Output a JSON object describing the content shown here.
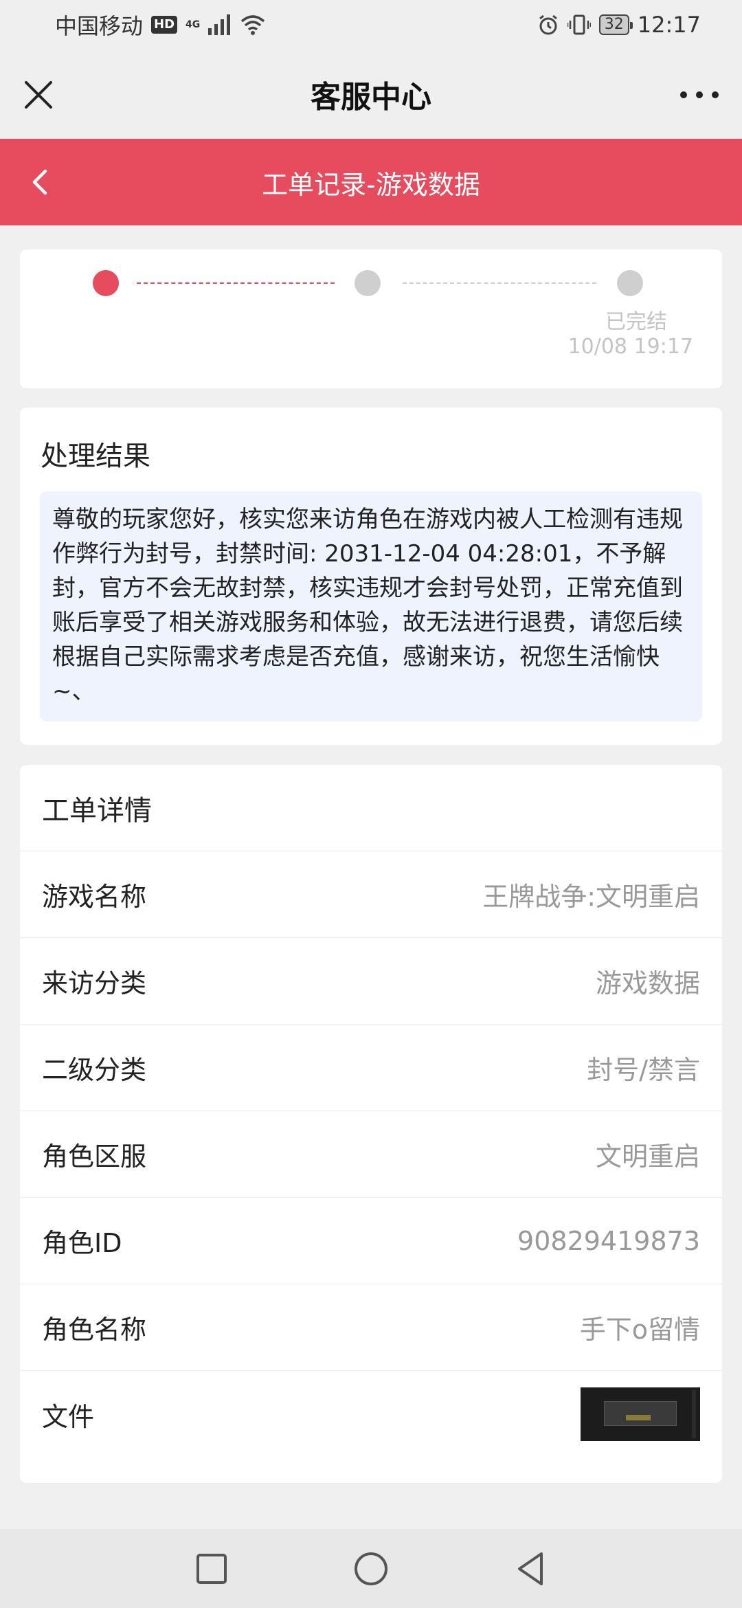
{
  "status_bar": {
    "carrier": "中国移动",
    "hd": "HD",
    "network": "4G",
    "battery": "32",
    "time": "12:17"
  },
  "top_nav": {
    "title": "客服中心"
  },
  "header": {
    "title": "工单记录-游戏数据"
  },
  "progress": {
    "status": "已完结",
    "time": "10/08 19:17"
  },
  "result": {
    "title": "处理结果",
    "text": "尊敬的玩家您好，核实您来访角色在游戏内被人工检测有违规作弊行为封号，封禁时间: 2031-12-04 04:28:01，不予解封，官方不会无故封禁，核实违规才会封号处罚，正常充值到账后享受了相关游戏服务和体验，故无法进行退费，请您后续根据自己实际需求考虑是否充值，感谢来访，祝您生活愉快~、"
  },
  "details": {
    "title": "工单详情",
    "rows": [
      {
        "label": "游戏名称",
        "value": "王牌战争:文明重启"
      },
      {
        "label": "来访分类",
        "value": "游戏数据"
      },
      {
        "label": "二级分类",
        "value": "封号/禁言"
      },
      {
        "label": "角色区服",
        "value": "文明重启"
      },
      {
        "label": "角色ID",
        "value": "90829419873"
      },
      {
        "label": "角色名称",
        "value": "手下o留情"
      },
      {
        "label": "文件",
        "value": ""
      }
    ]
  },
  "colors": {
    "accent": "#e64c5e",
    "result_bg": "#eff3fd"
  }
}
